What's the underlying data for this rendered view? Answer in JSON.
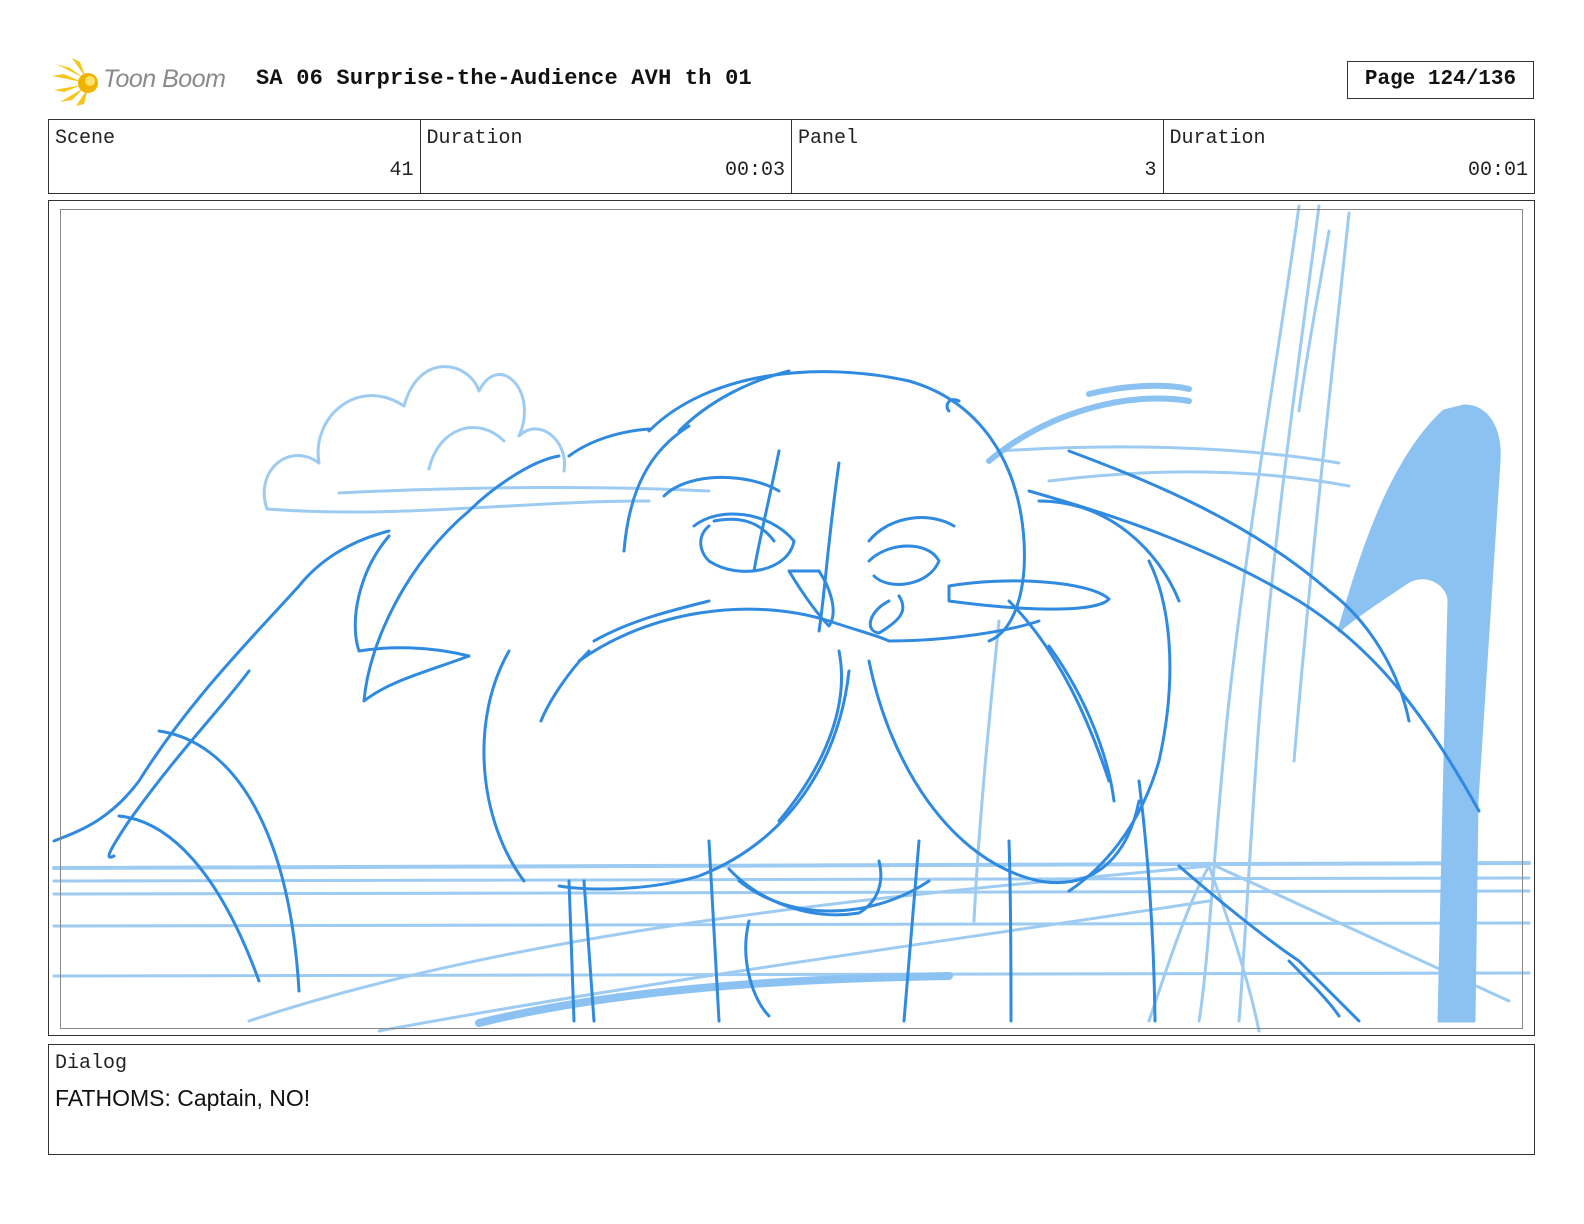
{
  "header": {
    "logo_text": "Toon Boom",
    "title": "SA 06 Surprise-the-Audience AVH th 01",
    "page": "Page 124/136"
  },
  "info": {
    "scene_label": "Scene",
    "scene_value": "41",
    "scene_duration_label": "Duration",
    "scene_duration_value": "00:03",
    "panel_label": "Panel",
    "panel_value": "3",
    "panel_duration_label": "Duration",
    "panel_duration_value": "00:01"
  },
  "dialog": {
    "label": "Dialog",
    "text": "FATHOMS: Captain, NO!"
  },
  "colors": {
    "sketch_dark": "#2f8ae0",
    "sketch_light": "#9dcbf2",
    "sketch_fill": "#8cc2f2",
    "logo_yellow": "#f5c518"
  },
  "icons": {
    "logo": "toon-boom-burst-icon"
  }
}
